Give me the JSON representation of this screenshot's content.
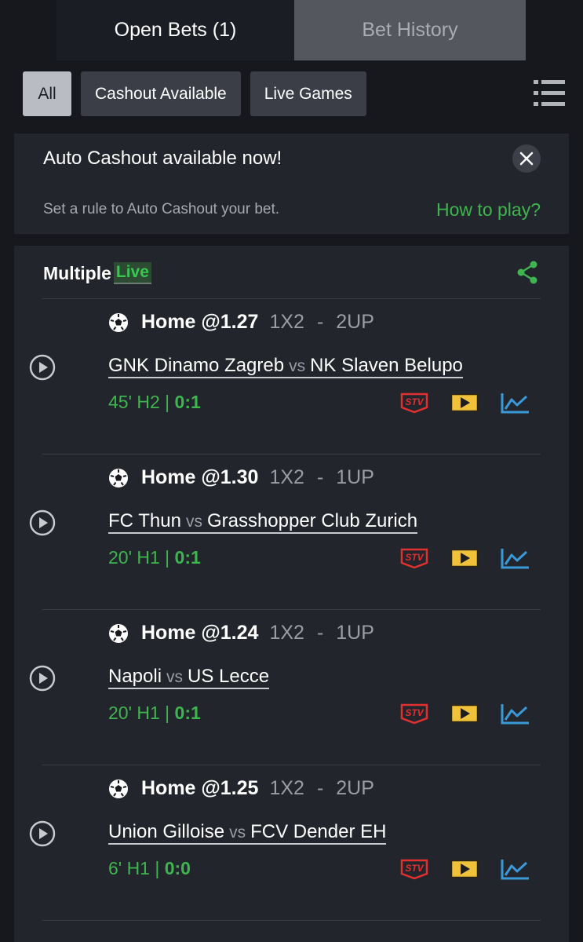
{
  "tabs": {
    "open_bets": "Open Bets (1)",
    "bet_history": "Bet History"
  },
  "filters": {
    "all": "All",
    "cashout": "Cashout Available",
    "live": "Live Games"
  },
  "banner": {
    "title": "Auto Cashout available now!",
    "subtitle": "Set a rule to Auto Cashout your bet.",
    "link": "How to play?"
  },
  "card": {
    "title": "Multiple",
    "live_badge": "Live"
  },
  "legs": [
    {
      "selection": "Home @1.27",
      "market": "1X2",
      "dash": "-",
      "boost": "2UP",
      "home": "GNK Dinamo Zagreb",
      "vs": "vs",
      "away": "NK Slaven Belupo",
      "time": "45' H2 |",
      "score": "0:1"
    },
    {
      "selection": "Home @1.30",
      "market": "1X2",
      "dash": "-",
      "boost": "1UP",
      "home": "FC Thun",
      "vs": "vs",
      "away": "Grasshopper Club Zurich",
      "time": "20' H1 |",
      "score": "0:1"
    },
    {
      "selection": "Home @1.24",
      "market": "1X2",
      "dash": "-",
      "boost": "1UP",
      "home": "Napoli",
      "vs": "vs",
      "away": "US Lecce",
      "time": "20' H1 |",
      "score": "0:1"
    },
    {
      "selection": "Home @1.25",
      "market": "1X2",
      "dash": "-",
      "boost": "2UP",
      "home": "Union Gilloise",
      "vs": "vs",
      "away": "FCV Dender EH",
      "time": "6' H1 |",
      "score": "0:0"
    }
  ],
  "colors": {
    "accent_green": "#3fb54f",
    "stv_red": "#e03030",
    "video_yellow": "#f0c23a",
    "stats_blue": "#3a9ad9"
  },
  "icons": [
    "menu-icon",
    "close-icon",
    "share-icon",
    "play-icon",
    "soccer-ball-icon",
    "stv-icon",
    "video-icon",
    "stats-icon"
  ]
}
